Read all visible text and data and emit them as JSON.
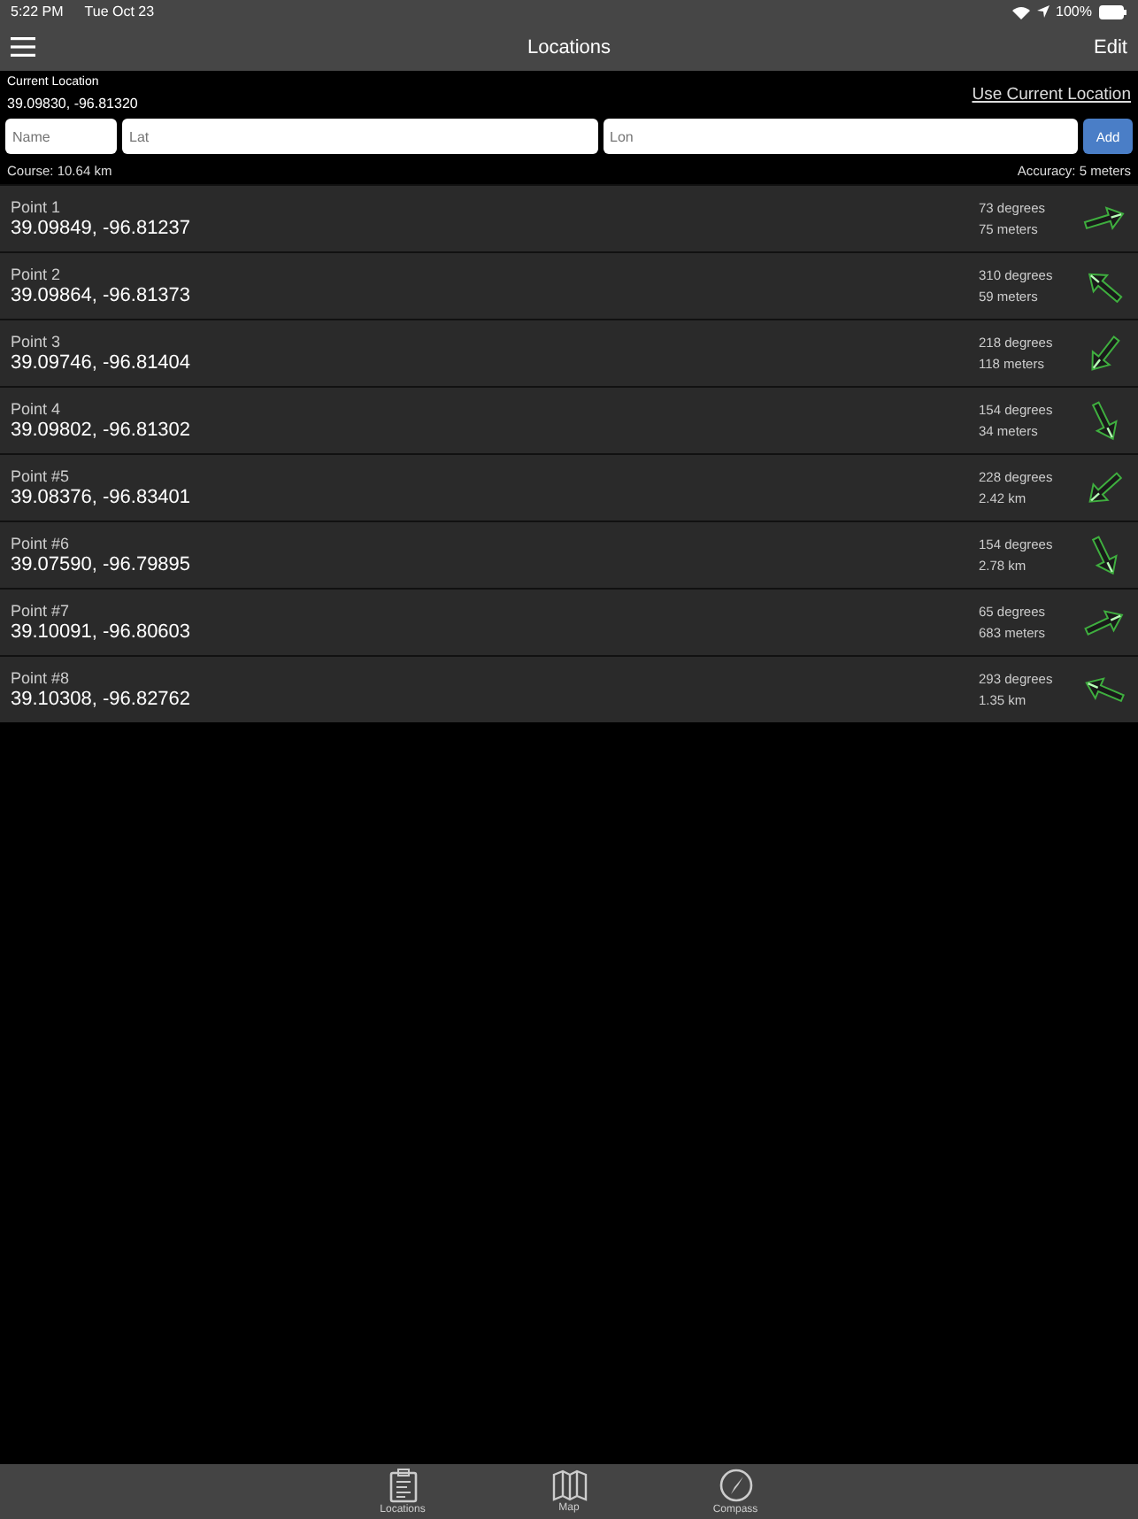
{
  "status_bar": {
    "time": "5:22 PM",
    "date": "Tue Oct 23",
    "battery": "100%"
  },
  "nav": {
    "title": "Locations",
    "edit": "Edit"
  },
  "current": {
    "label": "Current Location",
    "coords": "39.09830, -96.81320",
    "use_button": "Use Current Location"
  },
  "form": {
    "name_placeholder": "Name",
    "lat_placeholder": "Lat",
    "lon_placeholder": "Lon",
    "add": "Add"
  },
  "course": "Course: 10.64 km",
  "accuracy": "Accuracy: 5 meters",
  "points": [
    {
      "name": "Point 1",
      "coords": "39.09849, -96.81237",
      "bearing": "73 degrees",
      "distance": "75 meters"
    },
    {
      "name": "Point 2",
      "coords": "39.09864, -96.81373",
      "bearing": "310 degrees",
      "distance": "59 meters"
    },
    {
      "name": "Point 3",
      "coords": "39.09746, -96.81404",
      "bearing": "218 degrees",
      "distance": "118 meters"
    },
    {
      "name": "Point 4",
      "coords": "39.09802, -96.81302",
      "bearing": "154 degrees",
      "distance": "34 meters"
    },
    {
      "name": "Point #5",
      "coords": "39.08376, -96.83401",
      "bearing": "228 degrees",
      "distance": "2.42 km"
    },
    {
      "name": "Point #6",
      "coords": "39.07590, -96.79895",
      "bearing": "154 degrees",
      "distance": "2.78 km"
    },
    {
      "name": "Point #7",
      "coords": "39.10091, -96.80603",
      "bearing": "65 degrees",
      "distance": "683 meters"
    },
    {
      "name": "Point #8",
      "coords": "39.10308, -96.82762",
      "bearing": "293 degrees",
      "distance": "1.35 km"
    }
  ],
  "tabs": [
    {
      "label": "Locations",
      "kind": "clipboard",
      "selected": false
    },
    {
      "label": "Map",
      "kind": "map",
      "selected": false
    },
    {
      "label": "Compass",
      "kind": "compass",
      "selected": false
    }
  ]
}
